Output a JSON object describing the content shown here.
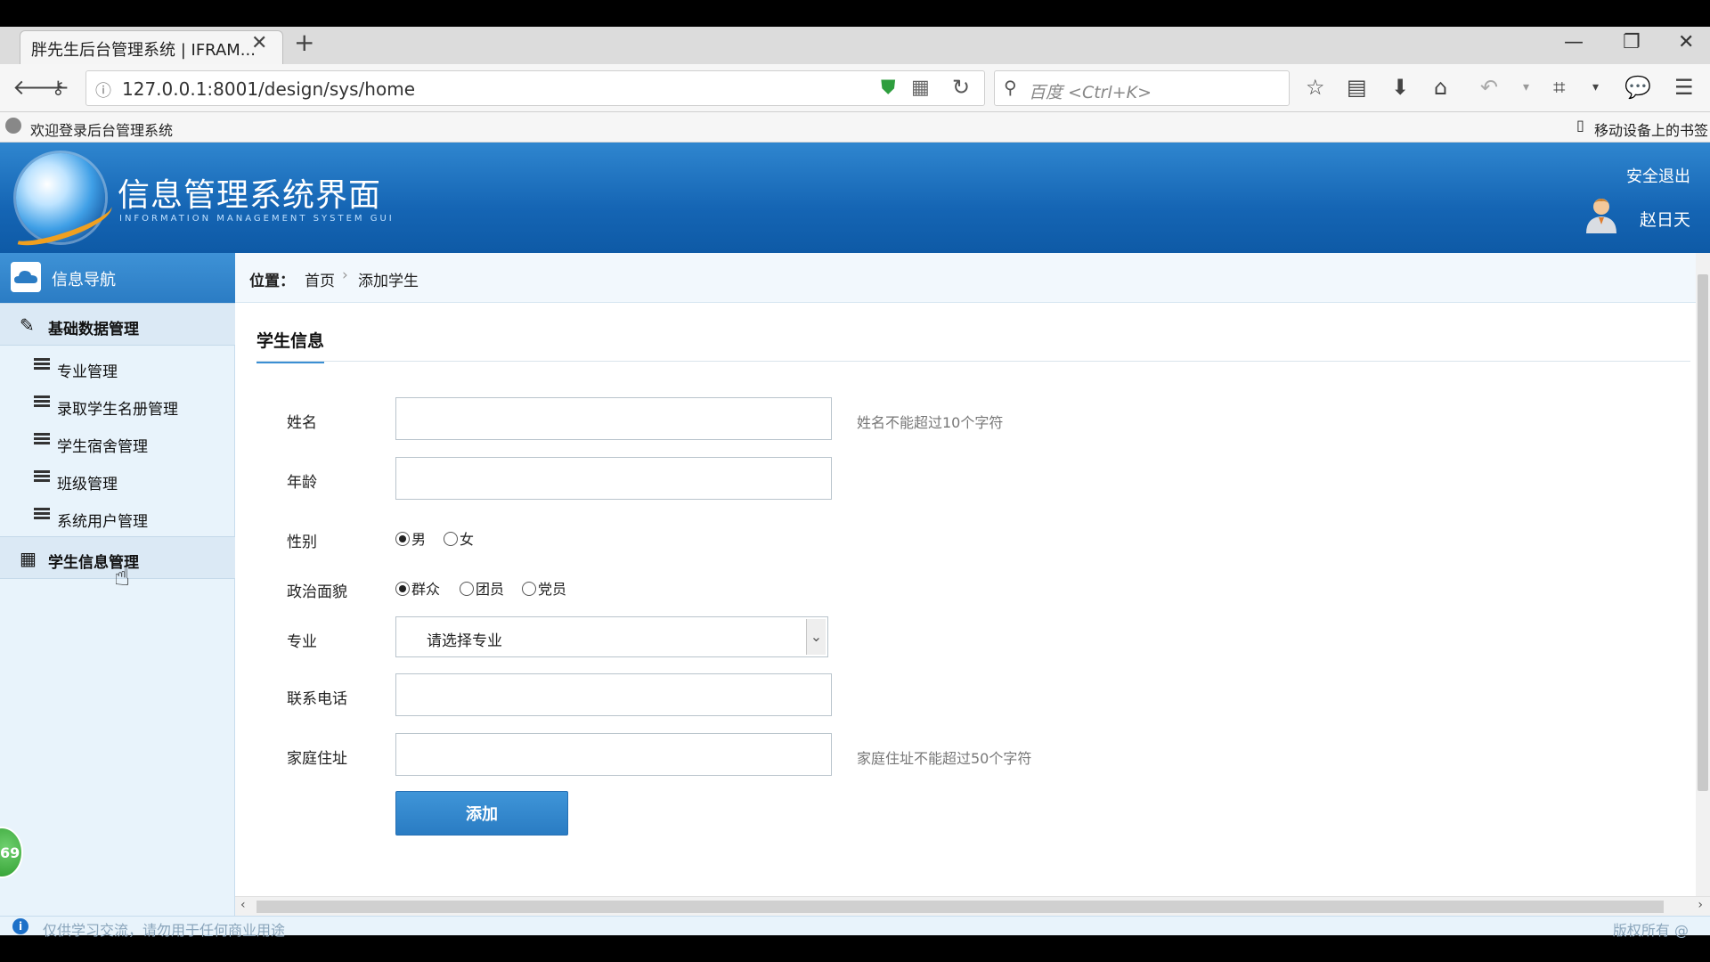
{
  "browser": {
    "tab_title": "胖先生后台管理系统 | IFRAM...",
    "tab_close": "✕",
    "new_tab": "+",
    "url": "127.0.0.1:8001/design/sys/home",
    "search_placeholder": "百度 <Ctrl+K>",
    "bookmark_item": "欢迎登录后台管理系统",
    "mobile_bookmarks": "移动设备上的书签"
  },
  "header": {
    "title": "信息管理系统界面",
    "subtitle": "INFORMATION MANAGEMENT SYSTEM GUI",
    "logout": "安全退出",
    "username": "赵日天"
  },
  "sidebar": {
    "nav_title": "信息导航",
    "group_basic": "基础数据管理",
    "items": [
      {
        "label": "专业管理"
      },
      {
        "label": "录取学生名册管理"
      },
      {
        "label": "学生宿舍管理"
      },
      {
        "label": "班级管理"
      },
      {
        "label": "系统用户管理"
      }
    ],
    "group_student": "学生信息管理",
    "badge": "69"
  },
  "breadcrumb": {
    "label": "位置：",
    "home": "首页",
    "separator": "›",
    "current": "添加学生"
  },
  "form": {
    "section_title": "学生信息",
    "name_label": "姓名",
    "name_value": "",
    "name_hint": "姓名不能超过10个字符",
    "age_label": "年龄",
    "age_value": "",
    "gender_label": "性别",
    "gender_male": "男",
    "gender_female": "女",
    "political_label": "政治面貌",
    "political_masses": "群众",
    "political_league": "团员",
    "political_party": "党员",
    "major_label": "专业",
    "major_selected": "请选择专业",
    "phone_label": "联系电话",
    "phone_value": "",
    "address_label": "家庭住址",
    "address_value": "",
    "address_hint": "家庭住址不能超过50个字符",
    "submit": "添加"
  },
  "footer": {
    "notice": "仅供学习交流，请勿用于任何商业用途",
    "copyright": "版权所有 @"
  },
  "colors": {
    "header_blue": "#1565b4",
    "accent_blue": "#3b8fd3",
    "sidebar_bg": "#e8f3fb"
  }
}
